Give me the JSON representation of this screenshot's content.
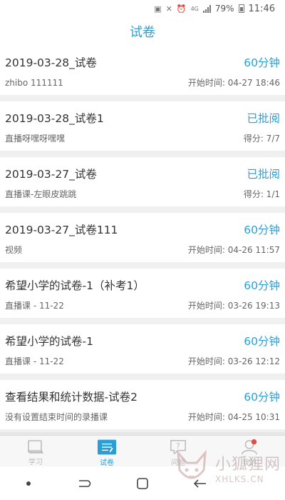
{
  "status_bar": {
    "network": "4G",
    "battery": "79%",
    "time": "11:46"
  },
  "header": {
    "title": "试卷"
  },
  "exams": [
    {
      "name": "2019-03-28_试卷",
      "status": "60分钟",
      "subtitle": "zhibo 111111",
      "info": "开始时间: 04-27 18:46"
    },
    {
      "name": "2019-03-28_试卷1",
      "status": "已批阅",
      "subtitle": "直播呀嘿呀嘿嘿",
      "info": "得分: 7/7"
    },
    {
      "name": "2019-03-27_试卷",
      "status": "已批阅",
      "subtitle": "直播课-左眼皮跳跳",
      "info": "得分: 1/1"
    },
    {
      "name": "2019-03-27_试卷111",
      "status": "60分钟",
      "subtitle": "视频",
      "info": "开始时间: 04-26 11:57"
    },
    {
      "name": "希望小学的试卷-1（补考1）",
      "status": "60分钟",
      "subtitle": "直播课 - 11-22",
      "info": "开始时间: 03-26 19:13"
    },
    {
      "name": "希望小学的试卷-1",
      "status": "60分钟",
      "subtitle": "直播课 - 11-22",
      "info": "开始时间: 03-26 12:12"
    },
    {
      "name": "查看结果和统计数据-试卷2",
      "status": "60分钟",
      "subtitle": "没有设置结束时间的录播课",
      "info": "开始时间: 04-25 10:31"
    }
  ],
  "tabs": [
    {
      "label": "学习",
      "icon": "book-icon"
    },
    {
      "label": "试卷",
      "icon": "exam-list-icon"
    },
    {
      "label": "问题",
      "icon": "question-chat-icon"
    },
    {
      "label": "我的",
      "icon": "profile-icon"
    }
  ],
  "watermark": {
    "cn": "小狐狸网",
    "en": "XHLKS.CN"
  },
  "colors": {
    "accent": "#2a9fd6",
    "notification": "#e84c3d"
  }
}
